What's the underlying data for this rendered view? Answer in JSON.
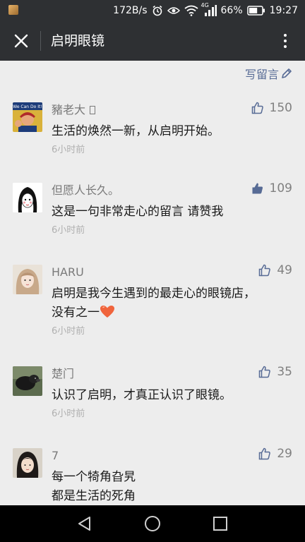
{
  "status_bar": {
    "network_speed": "172B/s",
    "network_type": "4G",
    "battery_percent": "66%",
    "battery_level": 0.66,
    "time": "19:27"
  },
  "header": {
    "title": "启明眼镜",
    "close_icon": "close-icon",
    "more_icon": "more-vertical-icon"
  },
  "write_comment": {
    "label": "写留言",
    "icon": "pencil-icon"
  },
  "comments": [
    {
      "nickname": "豬老大 ",
      "likes": "150",
      "text_lines": [
        "生活的焕然一新，从启明开始。"
      ],
      "time": "6小时前",
      "avatar_text": "We Can Do It!"
    },
    {
      "nickname": "但愿人长久。",
      "likes": "109",
      "text_lines": [
        "这是一句非常走心的留言 请赞我"
      ],
      "time": "6小时前"
    },
    {
      "nickname": "HARU",
      "likes": "49",
      "text_lines": [
        "启明是我今生遇到的最走心的眼镜店，",
        "没有之一"
      ],
      "time": "6小时前"
    },
    {
      "nickname": "楚门",
      "likes": "35",
      "text_lines": [
        "认识了启明，才真正认识了眼镜。"
      ],
      "time": "6小时前"
    },
    {
      "nickname": "7",
      "likes": "29",
      "text_lines": [
        "每一个犄角旮旯",
        "都是生活的死角"
      ],
      "time": ""
    }
  ],
  "colors": {
    "header_bg": "#2e3033",
    "page_bg": "#ededed",
    "link": "#576b95",
    "heart": "#f0643c"
  }
}
